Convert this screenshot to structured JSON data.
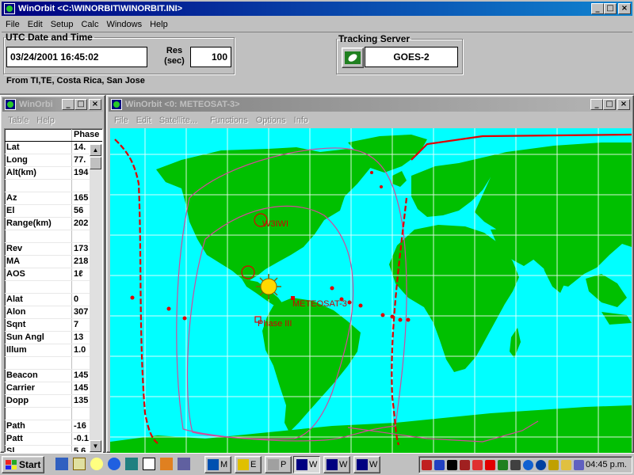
{
  "main": {
    "title": "WinOrbit  <C:\\WINORBIT\\WINORBIT.INI>",
    "menu": [
      "File",
      "Edit",
      "Setup",
      "Calc",
      "Windows",
      "Help"
    ],
    "utc_legend": "UTC Date and Time",
    "utc_value": "03/24/2001 16:45:02",
    "res_label": "Res",
    "res_unit": "(sec)",
    "res_value": "100",
    "tracking_legend": "Tracking Server",
    "tracking_value": "GOES-2",
    "location": "From TI,TE, Costa Rica, San Jose"
  },
  "panel": {
    "title": "WinOrbi",
    "menu": [
      "Table",
      "Help"
    ],
    "header": "Phase",
    "rows": [
      {
        "k": "Lat",
        "v": "14."
      },
      {
        "k": "Long",
        "v": "77."
      },
      {
        "k": "Alt(km)",
        "v": "194"
      },
      {
        "k": "",
        "v": ""
      },
      {
        "k": "Az",
        "v": "165"
      },
      {
        "k": "El",
        "v": "56"
      },
      {
        "k": "Range(km)",
        "v": "202"
      },
      {
        "k": "",
        "v": ""
      },
      {
        "k": "Rev",
        "v": "173"
      },
      {
        "k": "MA",
        "v": "218"
      },
      {
        "k": "AOS",
        "v": "1ℓ"
      },
      {
        "k": "",
        "v": ""
      },
      {
        "k": "Alat",
        "v": "0"
      },
      {
        "k": "Alon",
        "v": "307"
      },
      {
        "k": "Sqnt",
        "v": "7"
      },
      {
        "k": "Sun Angl",
        "v": "13"
      },
      {
        "k": "Illum",
        "v": "1.0"
      },
      {
        "k": "",
        "v": ""
      },
      {
        "k": "Beacon",
        "v": "145"
      },
      {
        "k": "Carrier",
        "v": "145"
      },
      {
        "k": "Dopp",
        "v": "135"
      },
      {
        "k": "",
        "v": ""
      },
      {
        "k": "Path",
        "v": "-16"
      },
      {
        "k": "Patt",
        "v": "-0.1"
      },
      {
        "k": "Sl",
        "v": "5.6"
      }
    ]
  },
  "map": {
    "title": "WinOrbit  <0: METEOSAT-3>",
    "menu": [
      "File",
      "Edit",
      "Satellite...",
      "Functions",
      "Options",
      "Info"
    ],
    "labels": {
      "w3iwi": "W3IWI",
      "meteosat": "METEOSAT-3",
      "phase3": "Phase III"
    },
    "colors": {
      "ocean": "#00ffff",
      "land": "#00c000",
      "track": "#d24a9b",
      "satellite": "#e00000"
    }
  },
  "taskbar": {
    "start": "Start",
    "tasks": [
      "M",
      "E",
      "P",
      "W",
      "W",
      "W"
    ],
    "clock": "04:45 p.m."
  }
}
